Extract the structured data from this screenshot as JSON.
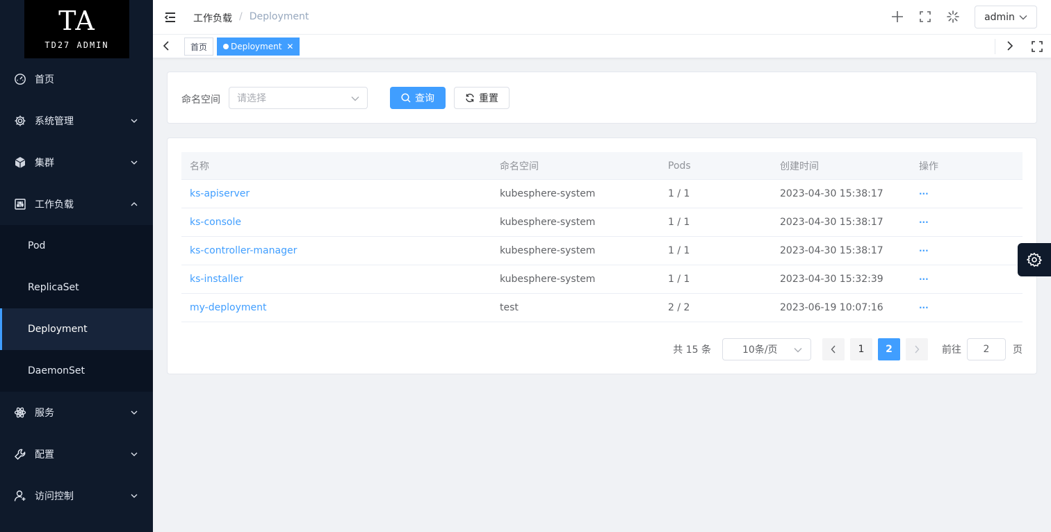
{
  "logo": {
    "mark": "TA",
    "text": "TD27 ADMIN"
  },
  "sidebar": {
    "items": [
      {
        "label": "首页",
        "icon": "dashboard-icon"
      },
      {
        "label": "系统管理",
        "icon": "gear-icon",
        "expandable": true
      },
      {
        "label": "集群",
        "icon": "cube-icon",
        "expandable": true
      },
      {
        "label": "工作负载",
        "icon": "sliders-icon",
        "expanded": true,
        "children": [
          "Pod",
          "ReplicaSet",
          "Deployment",
          "DaemonSet"
        ],
        "active_child": "Deployment"
      },
      {
        "label": "服务",
        "icon": "atom-icon",
        "expandable": true
      },
      {
        "label": "配置",
        "icon": "wrench-icon",
        "expandable": true
      },
      {
        "label": "访问控制",
        "icon": "user-icon",
        "expandable": true
      }
    ]
  },
  "header": {
    "breadcrumb": [
      "工作负载",
      "Deployment"
    ],
    "user": "admin"
  },
  "tags": {
    "home": "首页",
    "active": "Deployment"
  },
  "search": {
    "label": "命名空间",
    "placeholder": "请选择",
    "query_label": "查询",
    "reset_label": "重置"
  },
  "table": {
    "columns": [
      "名称",
      "命名空间",
      "Pods",
      "创建时间",
      "操作"
    ],
    "rows": [
      {
        "name": "ks-apiserver",
        "namespace": "kubesphere-system",
        "pods": "1 / 1",
        "created": "2023-04-30 15:38:17",
        "action": "···"
      },
      {
        "name": "ks-console",
        "namespace": "kubesphere-system",
        "pods": "1 / 1",
        "created": "2023-04-30 15:38:17",
        "action": "···"
      },
      {
        "name": "ks-controller-manager",
        "namespace": "kubesphere-system",
        "pods": "1 / 1",
        "created": "2023-04-30 15:38:17",
        "action": "···"
      },
      {
        "name": "ks-installer",
        "namespace": "kubesphere-system",
        "pods": "1 / 1",
        "created": "2023-04-30 15:32:39",
        "action": "···"
      },
      {
        "name": "my-deployment",
        "namespace": "test",
        "pods": "2 / 2",
        "created": "2023-06-19 10:07:16",
        "action": "···"
      }
    ]
  },
  "pagination": {
    "total": "共 15 条",
    "page_size": "10条/页",
    "pages": [
      "1",
      "2"
    ],
    "current": "2",
    "goto_label": "前往",
    "goto_value": "2",
    "goto_suffix": "页"
  },
  "colors": {
    "primary": "#409eff",
    "sidebar": "#0f1a2b"
  }
}
